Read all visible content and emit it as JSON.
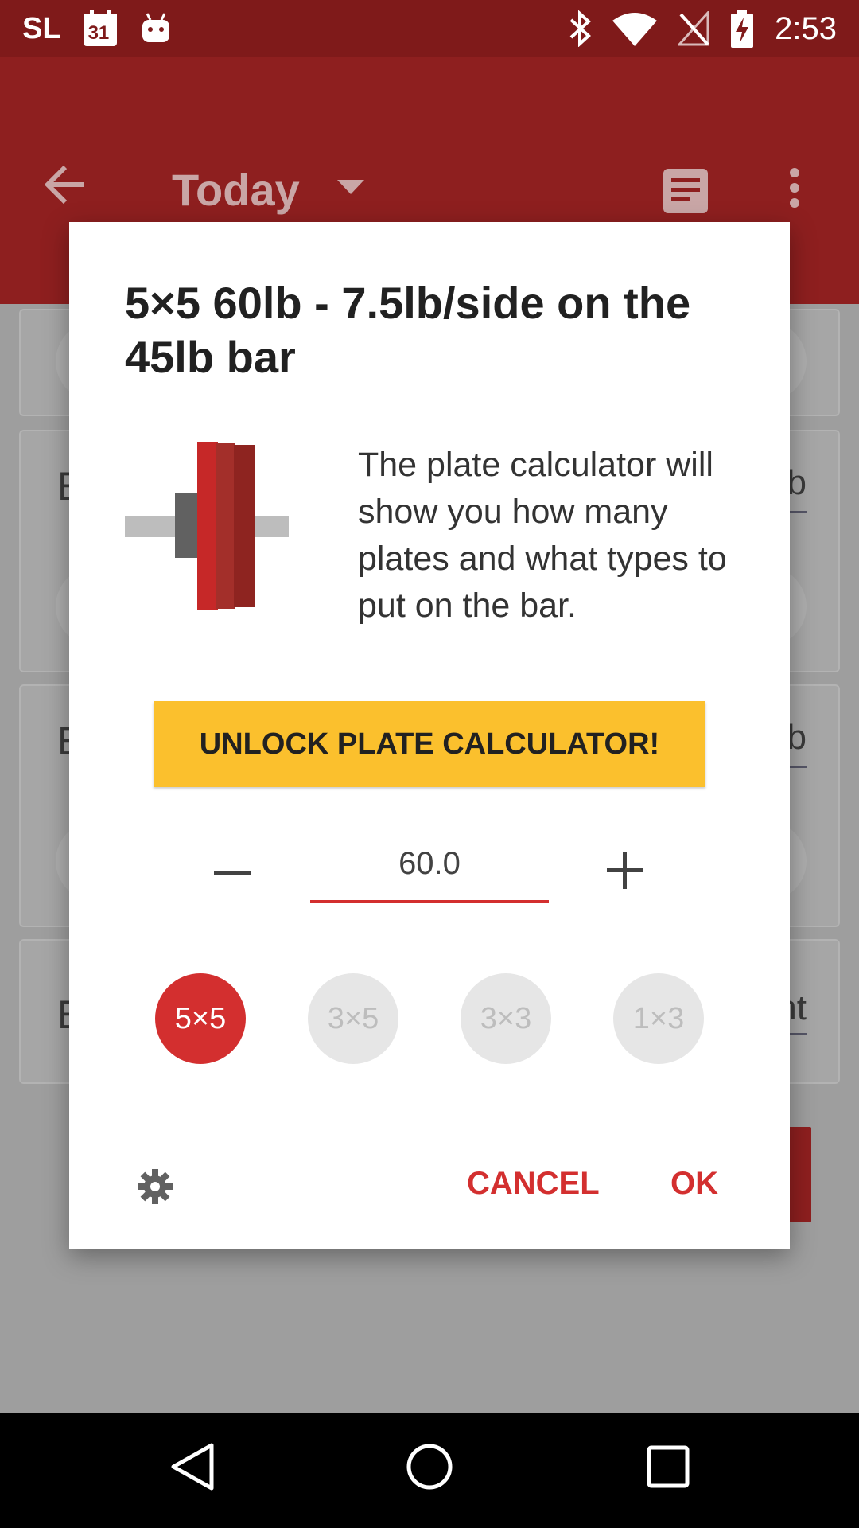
{
  "status_bar": {
    "carrier": "SL",
    "calendar_day": "31",
    "time": "2:53"
  },
  "app_bar": {
    "title": "Today"
  },
  "background": {
    "card_letters": [
      "E",
      "E",
      "E"
    ],
    "card_right_texts": [
      "b",
      "b",
      "nt"
    ]
  },
  "dialog": {
    "title": "5×5 60lb - 7.5lb/side on the 45lb bar",
    "description": "The plate calculator will show you how many plates and what types to put on the bar.",
    "unlock_label": "UNLOCK PLATE CALCULATOR!",
    "weight_value": "60.0",
    "minus_label": "–",
    "plus_label": "+",
    "schemes": [
      "5×5",
      "3×5",
      "3×3",
      "1×3"
    ],
    "selected_scheme": "5×5",
    "cancel_label": "CANCEL",
    "ok_label": "OK"
  },
  "colors": {
    "primary": "#8e1f1f",
    "accent": "#d32f2f",
    "unlock": "#fbc02d"
  }
}
